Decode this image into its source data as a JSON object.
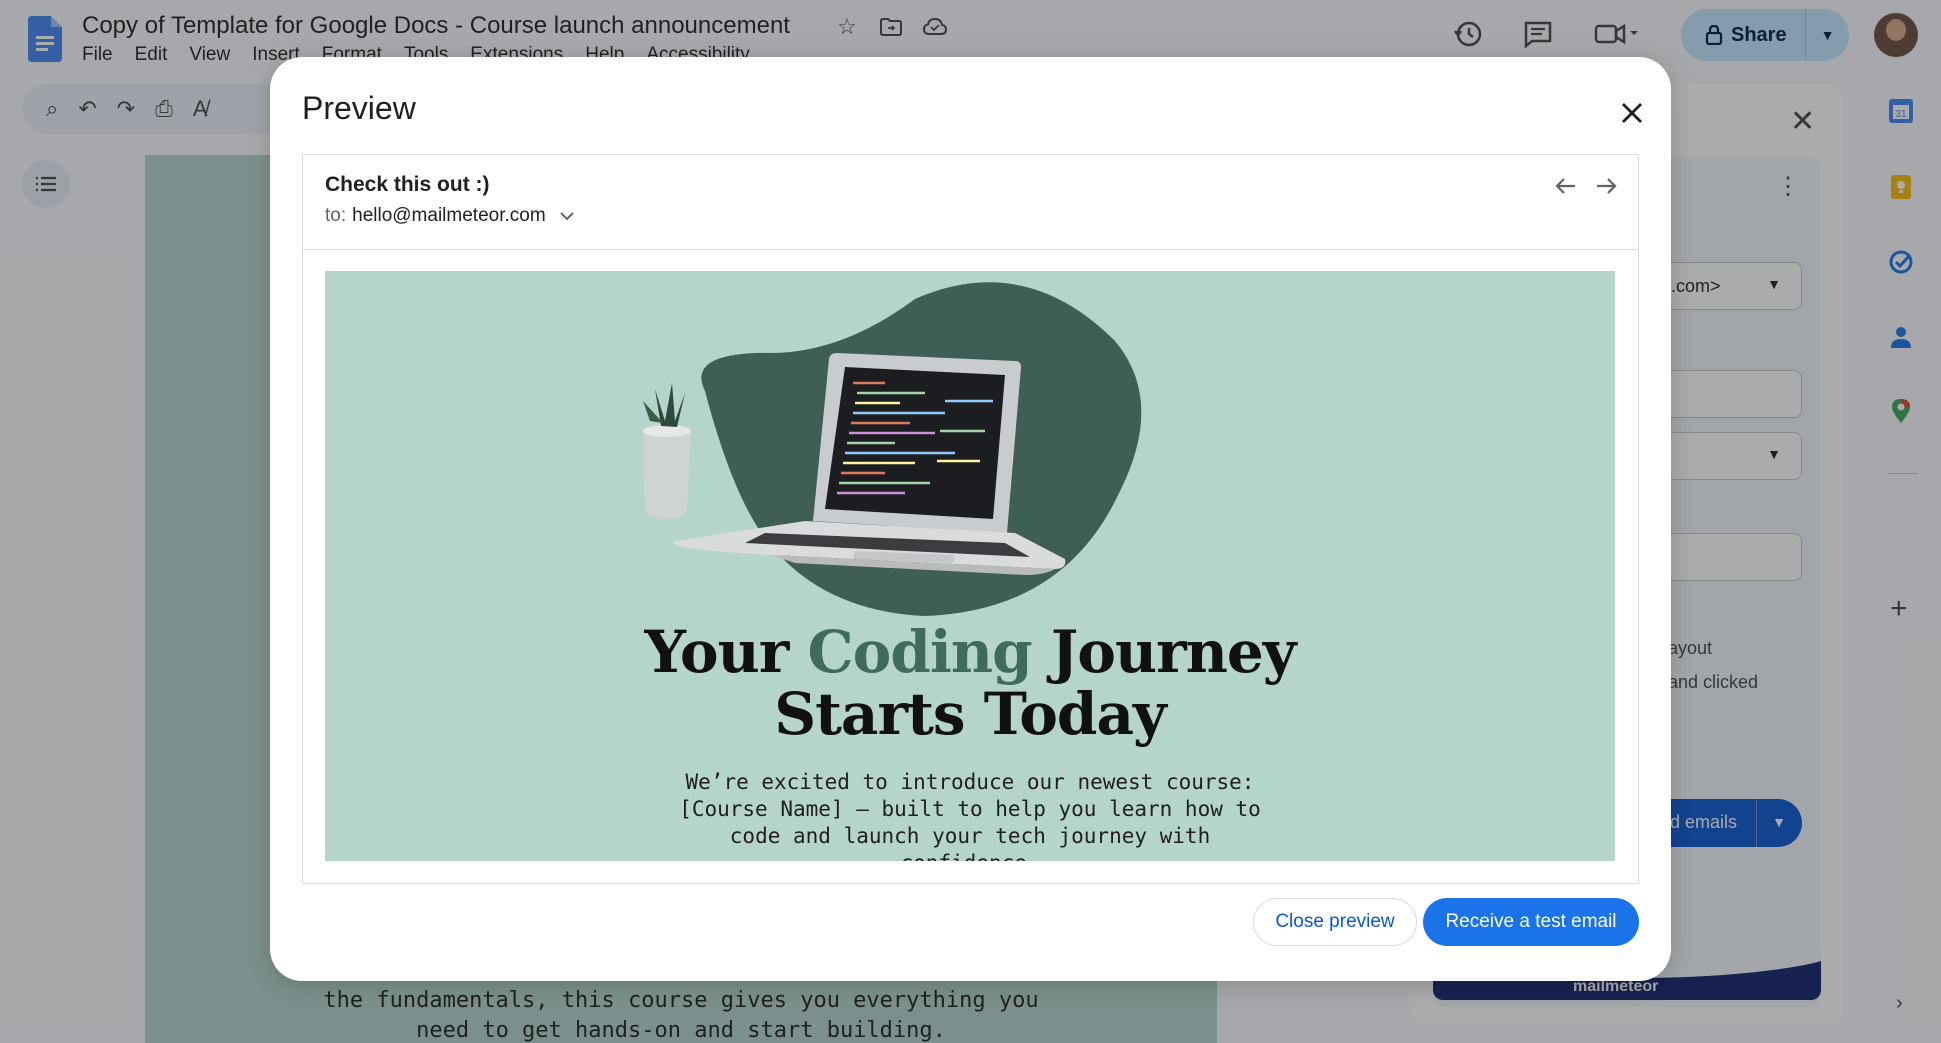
{
  "docs": {
    "title": "Copy of Template for Google Docs - Course launch announcement",
    "menu": [
      "File",
      "Edit",
      "View",
      "Insert",
      "Format",
      "Tools",
      "Extensions",
      "Help",
      "Accessibility"
    ],
    "share_label": "Share",
    "page_text_line1": "the fundamentals, this course gives you everything you",
    "page_text_line2": "need to get hands-on and start building."
  },
  "side_panel": {
    "from_value": ".com>",
    "text_line1": "ayout",
    "text_line2": "and clicked",
    "send_label": "d emails",
    "banner_brand": "mailmeteor"
  },
  "modal": {
    "title": "Preview",
    "email": {
      "subject": "Check this out :)",
      "to_prefix": "to:",
      "to_address": "hello@mailmeteor.com",
      "headline_part1": "Your ",
      "headline_accent": "Coding",
      "headline_part2": " Journey",
      "headline_line2": "Starts Today",
      "intro": "We’re excited to introduce our newest course: [Course Name] — built to help you learn how to code and launch your tech journey with confidence."
    },
    "close_preview_label": "Close preview",
    "test_email_label": "Receive a test email"
  },
  "colors": {
    "accent_blue": "#1a73e8",
    "hero_bg": "#b5d4cc",
    "blob": "#3f5e55",
    "headline_accent": "#3f6b5e"
  }
}
